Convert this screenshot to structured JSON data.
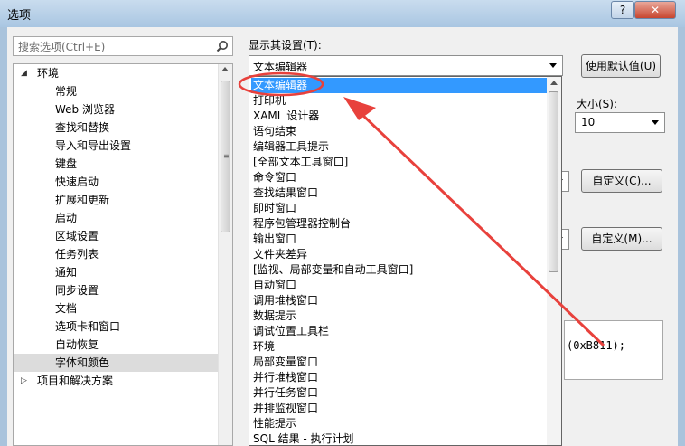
{
  "window": {
    "title": "选项",
    "help_label": "?",
    "close_label": "✕"
  },
  "search": {
    "placeholder": "搜索选项(Ctrl+E)"
  },
  "tree": {
    "items": [
      {
        "label": "环境",
        "expanded": true
      },
      {
        "label": "常规"
      },
      {
        "label": "Web 浏览器"
      },
      {
        "label": "查找和替换"
      },
      {
        "label": "导入和导出设置"
      },
      {
        "label": "键盘"
      },
      {
        "label": "快速启动"
      },
      {
        "label": "扩展和更新"
      },
      {
        "label": "启动"
      },
      {
        "label": "区域设置"
      },
      {
        "label": "任务列表"
      },
      {
        "label": "通知"
      },
      {
        "label": "同步设置"
      },
      {
        "label": "文档"
      },
      {
        "label": "选项卡和窗口"
      },
      {
        "label": "自动恢复"
      },
      {
        "label": "字体和颜色",
        "selected": true
      },
      {
        "label": "项目和解决方案",
        "expanded": false
      }
    ]
  },
  "settings": {
    "show_settings_for_label": "显示其设置(T):",
    "show_settings_for_value": "文本编辑器",
    "use_defaults_label": "使用默认值(U)",
    "size_label": "大小(S):",
    "size_value": "10",
    "custom_c_label": "自定义(C)...",
    "custom_m_label": "自定义(M)...",
    "preview_text": "(0xB811);"
  },
  "dropdown": {
    "options": [
      "文本编辑器",
      "打印机",
      "XAML 设计器",
      "语句结束",
      "编辑器工具提示",
      "[全部文本工具窗口]",
      "命令窗口",
      "查找结果窗口",
      "即时窗口",
      "程序包管理器控制台",
      "输出窗口",
      "文件夹差异",
      "[监视、局部变量和自动工具窗口]",
      "自动窗口",
      "调用堆栈窗口",
      "数据提示",
      "调试位置工具栏",
      "环境",
      "局部变量窗口",
      "并行堆栈窗口",
      "并行任务窗口",
      "并排监视窗口",
      "性能提示",
      "SQL 结果 - 执行计划"
    ],
    "highlighted_index": 0
  },
  "colors": {
    "highlight": "#3399ff",
    "annotation": "#e8413c"
  }
}
